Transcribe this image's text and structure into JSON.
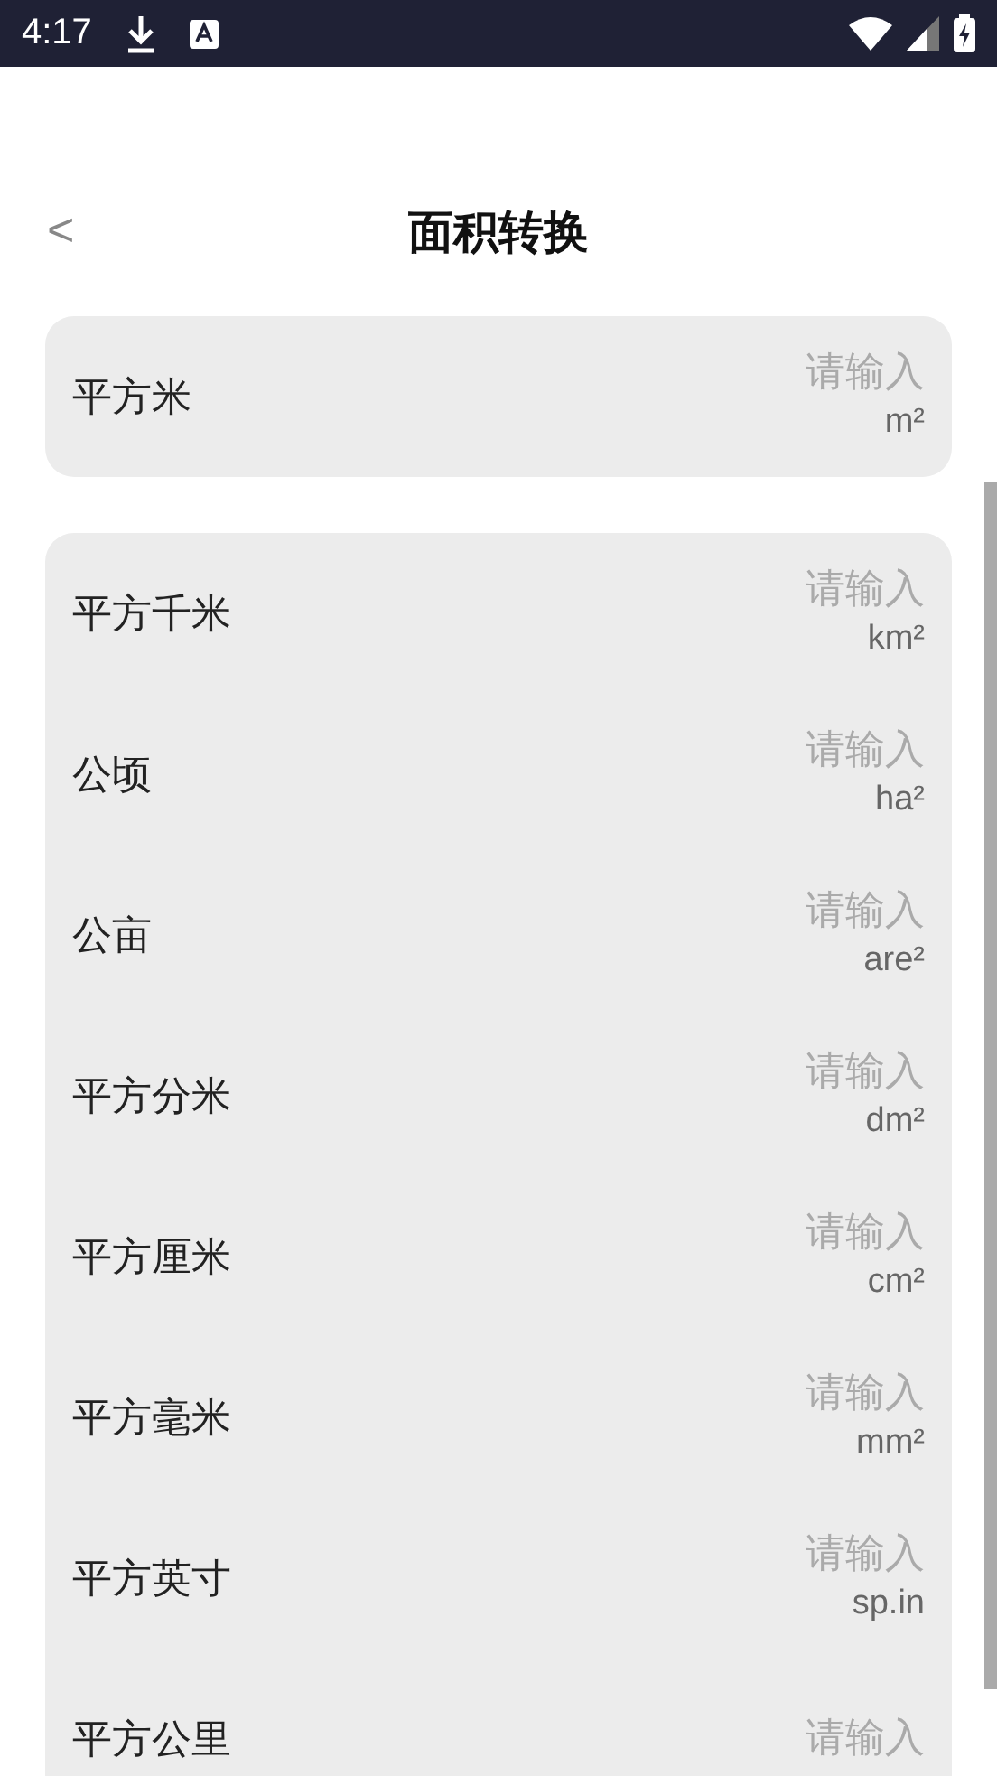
{
  "status_bar": {
    "time": "4:17"
  },
  "header": {
    "back": "<",
    "title": "面积转换"
  },
  "base_unit": {
    "name": "平方米",
    "placeholder": "请输入",
    "unit": "m²"
  },
  "units": [
    {
      "name": "平方千米",
      "placeholder": "请输入",
      "unit": "km²"
    },
    {
      "name": "公顷",
      "placeholder": "请输入",
      "unit": "ha²"
    },
    {
      "name": "公亩",
      "placeholder": "请输入",
      "unit": "are²"
    },
    {
      "name": "平方分米",
      "placeholder": "请输入",
      "unit": "dm²"
    },
    {
      "name": "平方厘米",
      "placeholder": "请输入",
      "unit": "cm²"
    },
    {
      "name": "平方毫米",
      "placeholder": "请输入",
      "unit": "mm²"
    },
    {
      "name": "平方英寸",
      "placeholder": "请输入",
      "unit": "sp.in"
    },
    {
      "name": "平方公里",
      "placeholder": "请输入"
    }
  ]
}
